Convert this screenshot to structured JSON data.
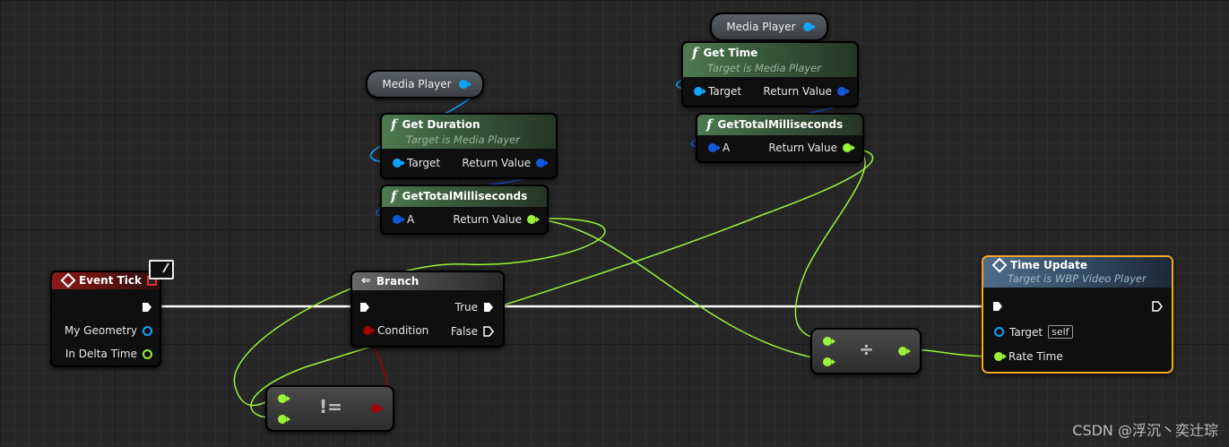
{
  "colors": {
    "exec": "#ffffff",
    "object": "#0ea5ff",
    "struct": "#1158d6",
    "float": "#9af23a",
    "bool": "#a00000",
    "selected_outline": "#f5a623"
  },
  "event_tick": {
    "title": "Event Tick",
    "pins": [
      "My Geometry",
      "In Delta Time"
    ],
    "icon": "event-diamond-icon"
  },
  "branch": {
    "title": "Branch",
    "condition": "Condition",
    "true_label": "True",
    "false_label": "False",
    "icon": "branch-icon"
  },
  "not_equal": {
    "symbol": "!="
  },
  "divide": {
    "symbol": "÷"
  },
  "media_player_1": {
    "label": "Media Player"
  },
  "media_player_2": {
    "label": "Media Player"
  },
  "get_duration": {
    "title": "Get Duration",
    "subtitle": "Target is Media Player",
    "target": "Target",
    "ret": "Return Value"
  },
  "get_total_ms_1": {
    "title": "GetTotalMilliseconds",
    "a": "A",
    "ret": "Return Value"
  },
  "get_time": {
    "title": "Get Time",
    "subtitle": "Target is Media Player",
    "target": "Target",
    "ret": "Return Value"
  },
  "get_total_ms_2": {
    "title": "GetTotalMilliseconds",
    "a": "A",
    "ret": "Return Value"
  },
  "time_update": {
    "title": "Time Update",
    "subtitle": "Target is WBP Video Player",
    "target": "Target",
    "self": "self",
    "rate": "Rate Time"
  },
  "watermark": "CSDN @浮沉丶奕辻琮"
}
